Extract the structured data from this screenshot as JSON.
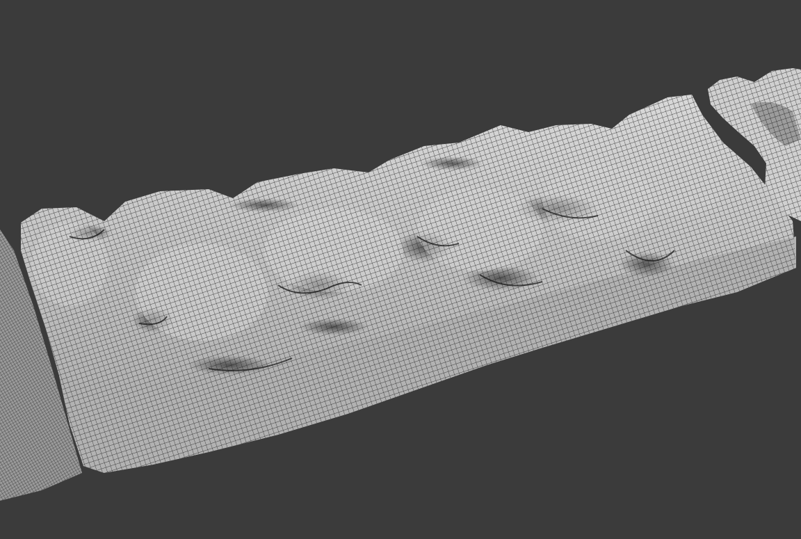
{
  "viewport": {
    "background_color": "#3b3b3b",
    "mesh_fill_color": "#c9c9c9",
    "mesh_shadow_color": "#8e8e8e",
    "wire_color": "#1a1a1a",
    "display_mode": "wireframe-on-shaded"
  },
  "objects": [
    {
      "name": "left-rock-scan-partial",
      "kind": "mesh"
    },
    {
      "name": "center-rock-scan-strip",
      "kind": "mesh"
    },
    {
      "name": "right-rock-scan-partial",
      "kind": "mesh"
    }
  ]
}
